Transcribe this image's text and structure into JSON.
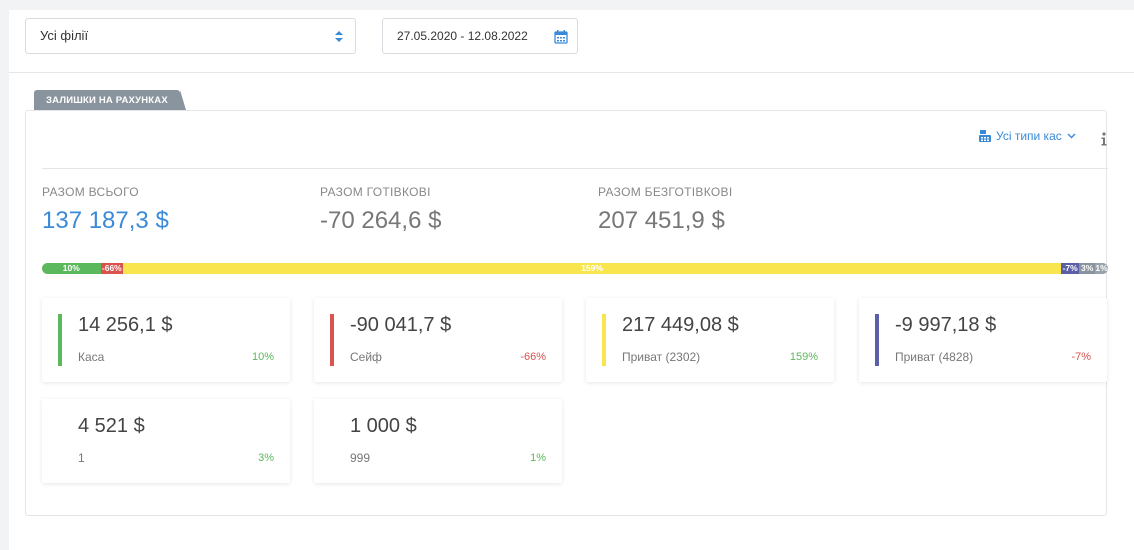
{
  "filters": {
    "branch": "Усі філії",
    "date_range": "27.05.2020 - 12.08.2022"
  },
  "tab": {
    "label": "ЗАЛИШКИ НА РАХУНКАХ"
  },
  "kas_filter": {
    "label": "Усі типи кас"
  },
  "totals": {
    "all": {
      "label": "РАЗОМ ВСЬОГО",
      "value": "137 187,3 $"
    },
    "cash": {
      "label": "РАЗОМ ГОТІВКОВІ",
      "value": "-70 264,6 $"
    },
    "noncash": {
      "label": "РАЗОМ БЕЗГОТІВКОВІ",
      "value": "207 451,9 $"
    }
  },
  "progress": [
    {
      "label": "10%",
      "share": 5.5,
      "color": "#5cb85c"
    },
    {
      "label": "-66%",
      "share": 2.1,
      "color": "#d9534f"
    },
    {
      "label": "159%",
      "share": 88.0,
      "color": "#f9e64f"
    },
    {
      "label": "-7%",
      "share": 1.7,
      "color": "#5a5fa8"
    },
    {
      "label": "3%",
      "share": 1.5,
      "color": "#8a949e"
    },
    {
      "label": "1%",
      "share": 1.2,
      "color": "#9aa3ab"
    }
  ],
  "accounts": [
    {
      "amount": "14 256,1 $",
      "name": "Каса",
      "percent": "10%",
      "stripe": "#5cb85c",
      "pct_color": "#5cb85c"
    },
    {
      "amount": "-90 041,7 $",
      "name": "Сейф",
      "percent": "-66%",
      "stripe": "#d9534f",
      "pct_color": "#d9534f"
    },
    {
      "amount": "217 449,08 $",
      "name": "Приват (2302)",
      "percent": "159%",
      "stripe": "#f9e64f",
      "pct_color": "#5cb85c"
    },
    {
      "amount": "-9 997,18 $",
      "name": "Приват (4828)",
      "percent": "-7%",
      "stripe": "#5a5fa8",
      "pct_color": "#d9534f"
    },
    {
      "amount": "4 521 $",
      "name": "1",
      "percent": "3%",
      "stripe": "",
      "pct_color": "#5cb85c"
    },
    {
      "amount": "1 000 $",
      "name": "999",
      "percent": "1%",
      "stripe": "",
      "pct_color": "#5cb85c"
    }
  ],
  "icons": {
    "select_arrows": "sort-arrows-icon",
    "calendar": "calendar-icon",
    "kas_filter": "cash-register-icon",
    "kas_chevron": "chevron-down-icon",
    "info": "info-icon"
  }
}
